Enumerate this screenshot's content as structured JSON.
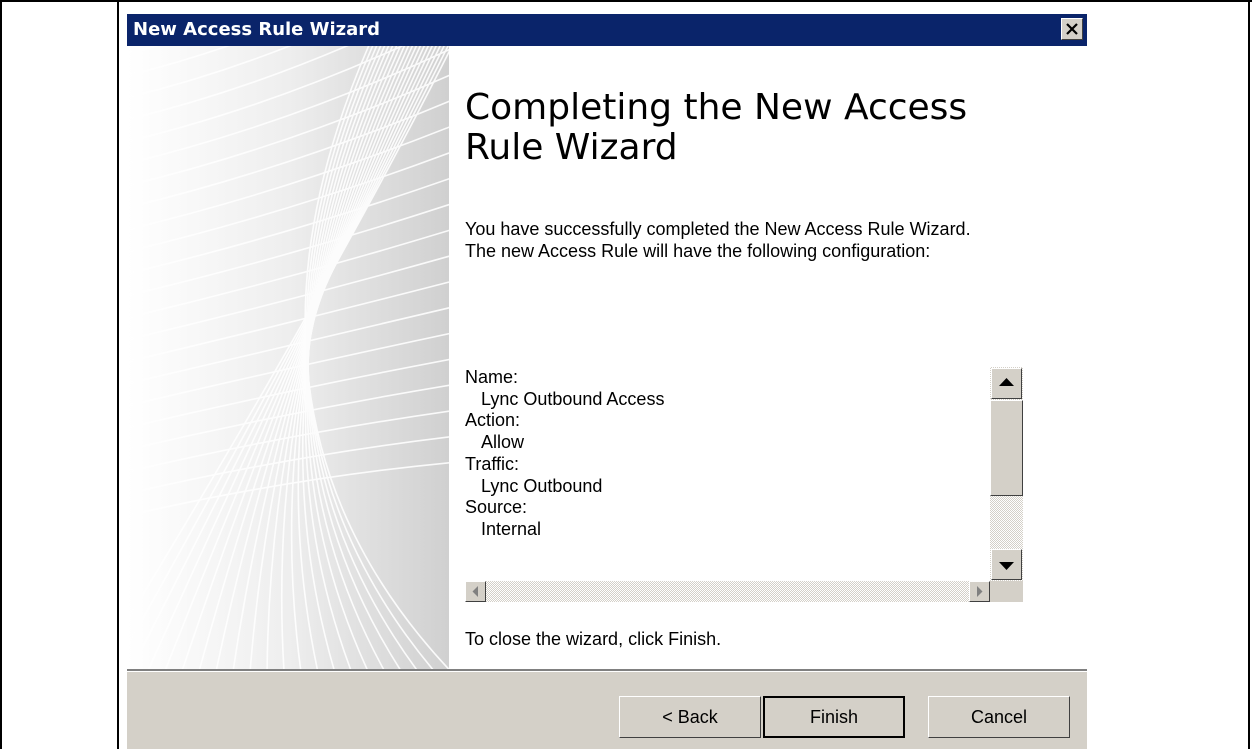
{
  "window": {
    "title": "New Access Rule Wizard"
  },
  "page": {
    "heading": "Completing the New Access Rule Wizard",
    "intro": "You have successfully completed the New Access Rule Wizard. The new Access Rule will have the following configuration:",
    "closing": "To close the wizard, click Finish."
  },
  "summary": {
    "name_label": "Name:",
    "name_value": "Lync Outbound Access",
    "action_label": "Action:",
    "action_value": "Allow",
    "traffic_label": "Traffic:",
    "traffic_value": "Lync Outbound",
    "source_label": "Source:",
    "source_value": "Internal"
  },
  "buttons": {
    "back": "< Back",
    "finish": "Finish",
    "cancel": "Cancel"
  },
  "icons": {
    "close": "close-icon",
    "scroll_up": "arrow-up-icon",
    "scroll_down": "arrow-down-icon",
    "scroll_left": "arrow-left-icon",
    "scroll_right": "arrow-right-icon"
  },
  "colors": {
    "titlebar": "#0a246a",
    "dialog_face": "#d4d0c8"
  }
}
